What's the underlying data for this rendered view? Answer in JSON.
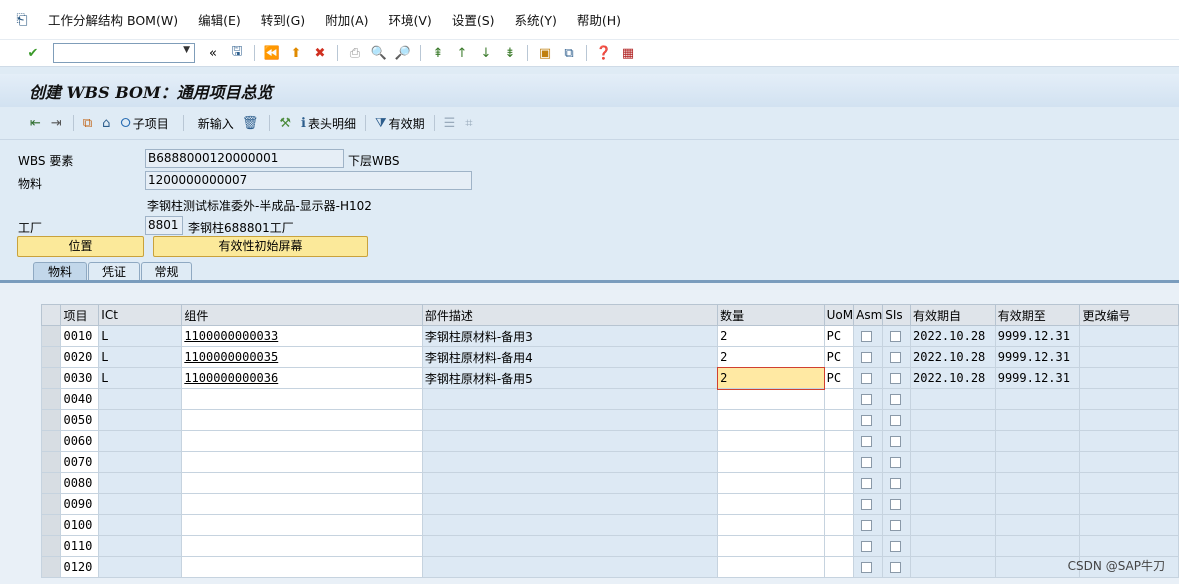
{
  "menu": {
    "items": [
      "工作分解结构 BOM(W)",
      "编辑(E)",
      "转到(G)",
      "附加(A)",
      "环境(V)",
      "设置(S)",
      "系统(Y)",
      "帮助(H)"
    ]
  },
  "title": "创建 WBS BOM：通用项目总览",
  "app_toolbar": {
    "subitem_label": "子项目",
    "new_entry_label": "新输入",
    "header_detail_label": "表头明细",
    "validity_label": "有效期"
  },
  "header": {
    "wbs_label": "WBS 要素",
    "wbs_value": "B6888000120000001",
    "wbs_suffix": "下层WBS",
    "material_label": "物料",
    "material_value": "1200000000007",
    "material_desc": "李钢柱测试标准委外-半成品-显示器-H102",
    "plant_label": "工厂",
    "plant_value": "8801",
    "plant_desc": "李钢柱688801工厂",
    "btn_position": "位置",
    "btn_validity_init": "有效性初始屏幕"
  },
  "tabs": [
    "物料",
    "凭证",
    "常规"
  ],
  "table": {
    "columns": [
      "项目",
      "ICt",
      "组件",
      "部件描述",
      "数量",
      "UoM",
      "Asm",
      "SIs",
      "有效期自",
      "有效期至",
      "更改编号"
    ],
    "rows": [
      {
        "item": "0010",
        "ict": "L",
        "component": "1100000000033",
        "desc": "李钢柱原材料-备用3",
        "qty": "2",
        "uom": "PC",
        "from": "2022.10.28",
        "to": "9999.12.31"
      },
      {
        "item": "0020",
        "ict": "L",
        "component": "1100000000035",
        "desc": "李钢柱原材料-备用4",
        "qty": "2",
        "uom": "PC",
        "from": "2022.10.28",
        "to": "9999.12.31"
      },
      {
        "item": "0030",
        "ict": "L",
        "component": "1100000000036",
        "desc": "李钢柱原材料-备用5",
        "qty": "2",
        "uom": "PC",
        "from": "2022.10.28",
        "to": "9999.12.31"
      },
      {
        "item": "0040",
        "ict": "",
        "component": "",
        "desc": "",
        "qty": "",
        "uom": "",
        "from": "",
        "to": ""
      },
      {
        "item": "0050",
        "ict": "",
        "component": "",
        "desc": "",
        "qty": "",
        "uom": "",
        "from": "",
        "to": ""
      },
      {
        "item": "0060",
        "ict": "",
        "component": "",
        "desc": "",
        "qty": "",
        "uom": "",
        "from": "",
        "to": ""
      },
      {
        "item": "0070",
        "ict": "",
        "component": "",
        "desc": "",
        "qty": "",
        "uom": "",
        "from": "",
        "to": ""
      },
      {
        "item": "0080",
        "ict": "",
        "component": "",
        "desc": "",
        "qty": "",
        "uom": "",
        "from": "",
        "to": ""
      },
      {
        "item": "0090",
        "ict": "",
        "component": "",
        "desc": "",
        "qty": "",
        "uom": "",
        "from": "",
        "to": ""
      },
      {
        "item": "0100",
        "ict": "",
        "component": "",
        "desc": "",
        "qty": "",
        "uom": "",
        "from": "",
        "to": ""
      },
      {
        "item": "0110",
        "ict": "",
        "component": "",
        "desc": "",
        "qty": "",
        "uom": "",
        "from": "",
        "to": ""
      },
      {
        "item": "0120",
        "ict": "",
        "component": "",
        "desc": "",
        "qty": "",
        "uom": "",
        "from": "",
        "to": ""
      }
    ]
  },
  "watermark": "CSDN @SAP牛刀"
}
